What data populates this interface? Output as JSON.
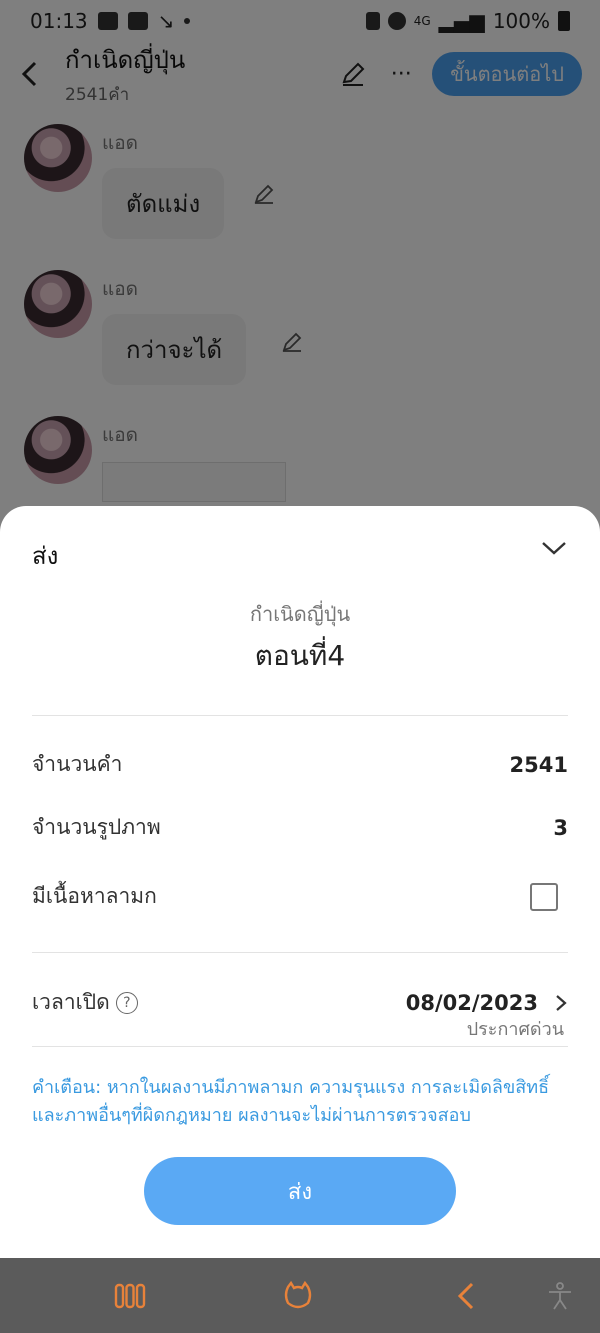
{
  "status_bar": {
    "time": "01:13",
    "battery": "100%",
    "network_label": "4G"
  },
  "header": {
    "title": "กำเนิดญี่ปุ่น",
    "word_count_label": "2541คำ",
    "next_step_label": "ขั้นตอนต่อไป",
    "more_label": "···"
  },
  "messages": [
    {
      "author": "แอด",
      "text": "ตัดแม่ง"
    },
    {
      "author": "แอด",
      "text": "กว่าจะได้"
    },
    {
      "author": "แอด",
      "text": ""
    }
  ],
  "sheet": {
    "header": "ส่ง",
    "story_name": "กำเนิดญี่ปุ่น",
    "episode": "ตอนที่4",
    "rows": {
      "word_count_label": "จำนวนคำ",
      "word_count_value": "2541",
      "image_count_label": "จำนวนรูปภาพ",
      "image_count_value": "3",
      "adult_content_label": "มีเนื้อหาลามก",
      "open_time_label": "เวลาเปิด",
      "open_time_value": "08/02/2023",
      "open_time_note": "ประกาศด่วน"
    },
    "help_icon_text": "?",
    "warning": "คำเตือน: หากในผลงานมีภาพลามก ความรุนแรง การละเมิดลิขสิทธิ์ และภาพอื่นๆที่ผิดกฎหมาย ผลงานจะไม่ผ่านการตรวจสอบ",
    "send_label": "ส่ง"
  },
  "colors": {
    "accent": "#5aa9f4",
    "warning_text": "#3a9ae0",
    "navbar_icons": "#e8823a"
  }
}
